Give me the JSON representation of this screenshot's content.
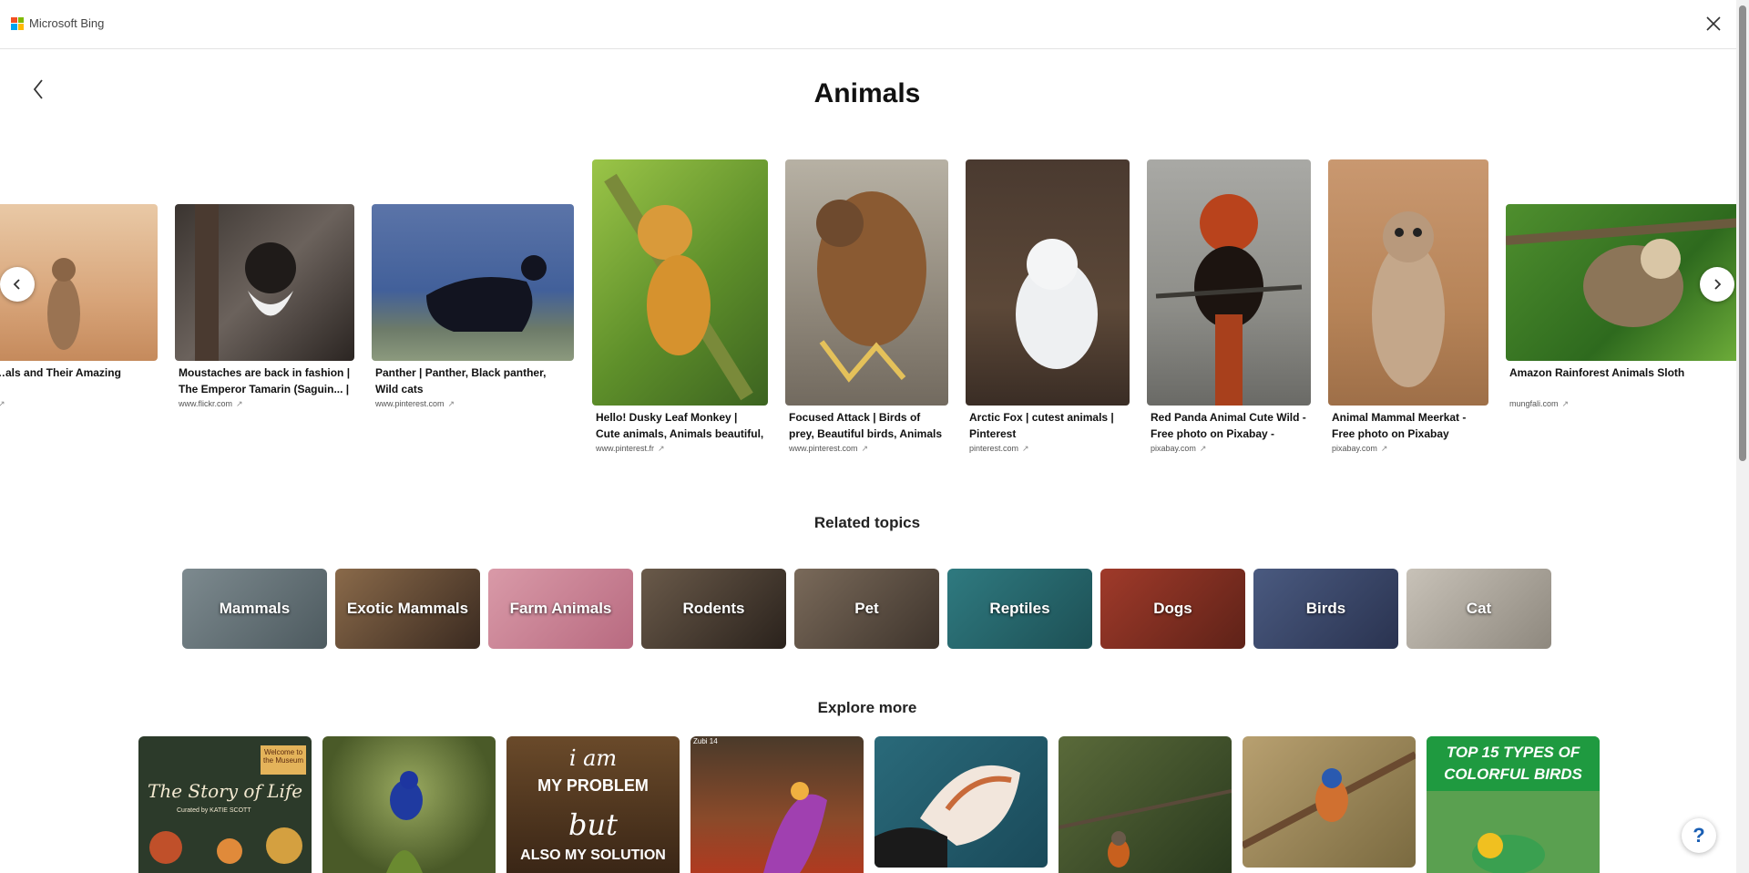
{
  "app": {
    "brand": "Microsoft Bing"
  },
  "page": {
    "title": "Animals"
  },
  "carousel": [
    {
      "caption": "…als and Their Amazing",
      "source": ""
    },
    {
      "caption": "Moustaches are back in fashion | The Emperor Tamarin (Saguin... |",
      "source": "www.flickr.com"
    },
    {
      "caption": "Panther | Panther, Black panther, Wild cats",
      "source": "www.pinterest.com"
    },
    {
      "caption": "Hello! Dusky Leaf Monkey | Cute animals, Animals beautiful, Animals",
      "source": "www.pinterest.fr"
    },
    {
      "caption": "Focused Attack | Birds of prey, Beautiful birds, Animals beautiful",
      "source": "www.pinterest.com"
    },
    {
      "caption": "Arctic Fox | cutest animals | Pinterest",
      "source": "pinterest.com"
    },
    {
      "caption": "Red Panda Animal Cute Wild - Free photo on Pixabay - Pixabay",
      "source": "pixabay.com"
    },
    {
      "caption": "Animal Mammal Meerkat - Free photo on Pixabay",
      "source": "pixabay.com"
    },
    {
      "caption": "Amazon Rainforest Animals Sloth",
      "source": "mungfali.com"
    }
  ],
  "related": {
    "title": "Related topics",
    "topics": [
      "Mammals",
      "Exotic Mammals",
      "Farm Animals",
      "Rodents",
      "Pet",
      "Reptiles",
      "Dogs",
      "Birds",
      "Cat"
    ]
  },
  "explore": {
    "title": "Explore more",
    "items": [
      {
        "line1": "Welcome to the Museum",
        "line2": "The Story of Life",
        "line3": "Curated by KATIE SCOTT"
      },
      {
        "label": ""
      },
      {
        "line1": "i am",
        "line2": "MY PROBLEM",
        "line3": "but",
        "line4": "ALSO MY SOLUTION"
      },
      {
        "tag": "Zubi 14"
      },
      {
        "label": ""
      },
      {
        "label": ""
      },
      {
        "label": ""
      },
      {
        "line1": "TOP 15 TYPES OF",
        "line2": "COLORFUL BIRDS"
      }
    ]
  },
  "help": {
    "label": "?"
  }
}
